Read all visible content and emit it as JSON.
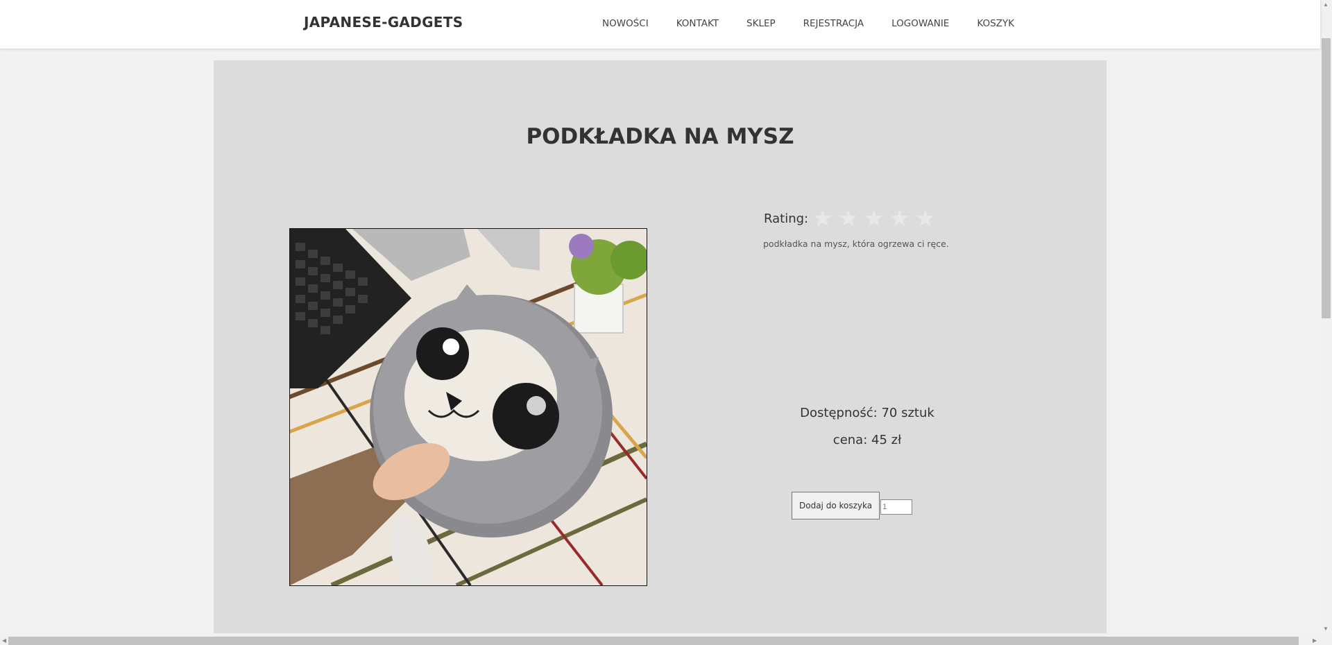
{
  "header": {
    "brand": "JAPANESE-GADGETS",
    "nav": [
      "NOWOŚCI",
      "KONTAKT",
      "SKLEP",
      "REJESTRACJA",
      "LOGOWANIE",
      "KOSZYK"
    ]
  },
  "product": {
    "title": "PODKŁADKA NA MYSZ",
    "rating_label": "Rating:",
    "rating_value": 0,
    "rating_max": 5,
    "description": "podkładka na mysz, która ogrzewa ci ręce.",
    "availability": "Dostępność: 70 sztuk",
    "price": "cena: 45 zł",
    "add_to_cart_label": "Dodaj do koszyka",
    "quantity_value": "1"
  },
  "icons": {
    "star": "star-icon",
    "scroll_up": "scroll-up-arrow-icon",
    "scroll_down": "scroll-down-arrow-icon",
    "scroll_left": "scroll-left-arrow-icon",
    "scroll_right": "scroll-right-arrow-icon"
  },
  "colors": {
    "page_background": "#f2f2f2",
    "header_background": "#ffffff",
    "panel_background": "#dcdcdc",
    "text": "#333333",
    "star_empty": "#e8e8e8"
  }
}
